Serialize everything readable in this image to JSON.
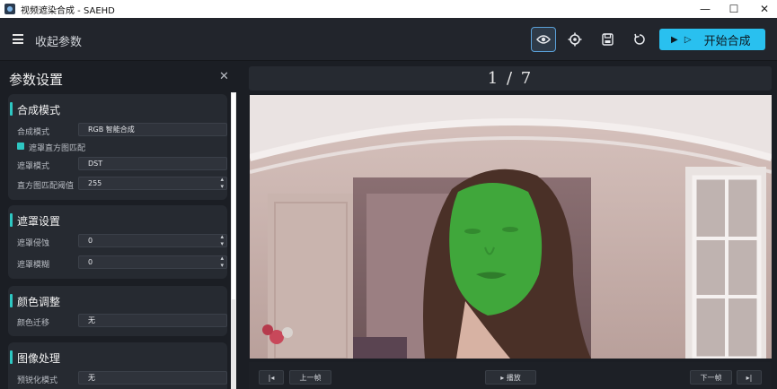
{
  "window": {
    "title": "视频遮染合成 - SAEHD",
    "minimize": "—",
    "maximize": "☐",
    "close": "✕"
  },
  "toolbar": {
    "collapse_label": "收起参数",
    "icons": [
      "menu-icon",
      "eye-icon",
      "gear-icon",
      "save-icon",
      "refresh-icon"
    ],
    "start_icon": "▶ ▷",
    "start_label": "开始合成",
    "accent": "#29c0ef"
  },
  "side": {
    "title": "参数设置",
    "close": "✕",
    "sections": {
      "composite": {
        "title": "合成模式",
        "mode_label": "合成模式",
        "mode_value": "RGB 智能合成",
        "hist_match_label": "遮罩直方图匹配",
        "mask_mode_label": "遮罩模式",
        "mask_mode_value": "DST",
        "hist_threshold_label": "直方图匹配阈值",
        "hist_threshold_value": "255"
      },
      "mask": {
        "title": "遮罩设置",
        "erode_label": "遮罩侵蚀",
        "erode_value": "0",
        "blur_label": "遮罩模糊",
        "blur_value": "0"
      },
      "color": {
        "title": "颜色调整",
        "transfer_label": "颜色迁移",
        "transfer_value": "无"
      },
      "image": {
        "title": "图像处理",
        "sharpen_label": "预锐化模式",
        "sharpen_value": "无"
      }
    },
    "accent": "#2ec7c2"
  },
  "main": {
    "counter": "1 / 7",
    "buttons": {
      "first": "|◂",
      "prev": "上一帧",
      "play": "▸ 播放",
      "next": "下一帧",
      "last": "▸|"
    },
    "mask_color": "#3fae3c"
  }
}
